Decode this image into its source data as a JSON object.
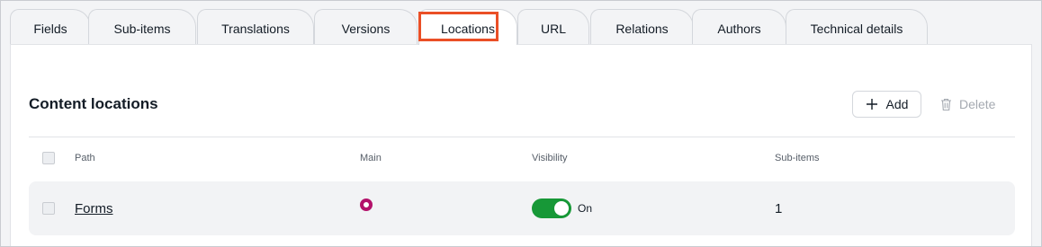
{
  "tabs": [
    {
      "label": "Fields"
    },
    {
      "label": "Sub-items"
    },
    {
      "label": "Translations"
    },
    {
      "label": "Versions"
    },
    {
      "label": "Locations"
    },
    {
      "label": "URL"
    },
    {
      "label": "Relations"
    },
    {
      "label": "Authors"
    },
    {
      "label": "Technical details"
    }
  ],
  "active_tab": "Locations",
  "section": {
    "title": "Content locations",
    "add_label": "Add",
    "delete_label": "Delete"
  },
  "table": {
    "columns": [
      "Path",
      "Main",
      "Visibility",
      "Sub-items"
    ],
    "rows": [
      {
        "path": "Forms",
        "main": true,
        "visibility": "On",
        "visible": true,
        "sub_items": "1"
      }
    ]
  },
  "colors": {
    "highlight": "#ea4f26",
    "main_radio": "#b3116a",
    "toggle_on": "#179837"
  }
}
